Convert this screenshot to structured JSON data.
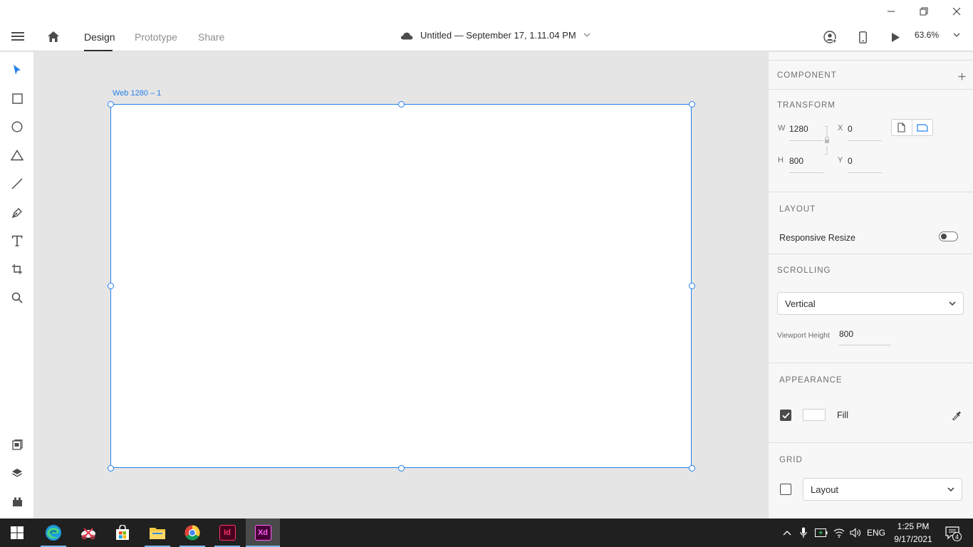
{
  "window": {
    "minimize_icon": "minimize-icon",
    "restore_icon": "restore-icon",
    "close_icon": "close-icon"
  },
  "header": {
    "tabs": [
      {
        "label": "Design",
        "active": true
      },
      {
        "label": "Prototype",
        "active": false
      },
      {
        "label": "Share",
        "active": false
      }
    ],
    "doc_title": "Untitled — September 17, 1.11.04 PM",
    "zoom": "63.6%"
  },
  "tools": [
    "select-tool",
    "rectangle-tool",
    "ellipse-tool",
    "polygon-tool",
    "line-tool",
    "pen-tool",
    "text-tool",
    "artboard-tool",
    "zoom-tool",
    "assets-panel",
    "layers-panel",
    "plugins-panel"
  ],
  "canvas": {
    "artboard_label": "Web 1280 – 1"
  },
  "inspector": {
    "component": {
      "title": "COMPONENT"
    },
    "transform": {
      "title": "TRANSFORM",
      "w_label": "W",
      "w_value": "1280",
      "x_label": "X",
      "x_value": "0",
      "h_label": "H",
      "h_value": "800",
      "y_label": "Y",
      "y_value": "0"
    },
    "layout": {
      "title": "LAYOUT",
      "responsive_label": "Responsive Resize",
      "responsive_on": false
    },
    "scrolling": {
      "title": "SCROLLING",
      "mode": "Vertical",
      "viewport_label": "Viewport Height",
      "viewport_value": "800"
    },
    "appearance": {
      "title": "APPEARANCE",
      "fill_label": "Fill",
      "fill_checked": true,
      "fill_color": "#ffffff"
    },
    "grid": {
      "title": "GRID",
      "grid_checked": false,
      "mode": "Layout"
    }
  },
  "taskbar": {
    "apps": [
      "Windows Start",
      "Microsoft Edge",
      "Snipping app",
      "Microsoft Store",
      "File Explorer",
      "Google Chrome",
      "Adobe InDesign",
      "Adobe XD"
    ],
    "indesign_label": "Id",
    "xd_label": "Xd",
    "language": "ENG",
    "time": "1:25 PM",
    "date": "9/17/2021",
    "notification_count": "4"
  },
  "colors": {
    "accent": "#2680eb",
    "xd_brand": "#ff61f6",
    "xd_bg": "#470137",
    "id_brand": "#ff3366",
    "id_bg": "#49021f"
  }
}
